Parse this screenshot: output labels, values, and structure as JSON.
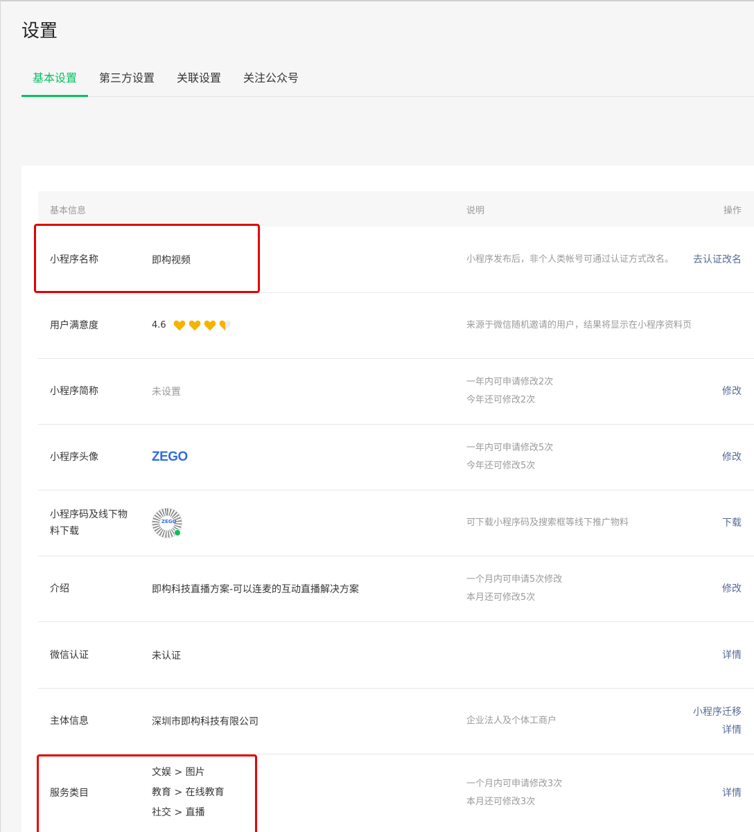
{
  "page": {
    "title": "设置"
  },
  "tabs": [
    {
      "label": "基本设置",
      "active": true
    },
    {
      "label": "第三方设置",
      "active": false
    },
    {
      "label": "关联设置",
      "active": false
    },
    {
      "label": "关注公众号",
      "active": false
    }
  ],
  "table": {
    "headers": {
      "info": "基本信息",
      "desc": "说明",
      "op": "操作"
    },
    "rows": [
      {
        "label": "小程序名称",
        "value": "即构视频",
        "desc": [
          "小程序发布后，非个人类帐号可通过认证方式改名。"
        ],
        "ops": [
          "去认证改名"
        ]
      },
      {
        "label": "用户满意度",
        "value": "4.6",
        "rating": 3.5,
        "desc": [
          "来源于微信随机邀请的用户，结果将显示在小程序资料页"
        ],
        "ops": []
      },
      {
        "label": "小程序简称",
        "value": "未设置",
        "desc": [
          "一年内可申请修改2次",
          "今年还可修改2次"
        ],
        "ops": [
          "修改"
        ]
      },
      {
        "label": "小程序头像",
        "value": "ZEGO",
        "desc": [
          "一年内可申请修改5次",
          "今年还可修改5次"
        ],
        "ops": [
          "修改"
        ]
      },
      {
        "label": "小程序码及线下物料下载",
        "value": "ZEGO",
        "desc": [
          "可下载小程序码及搜索框等线下推广物料"
        ],
        "ops": [
          "下载"
        ]
      },
      {
        "label": "介绍",
        "value": "即构科技直播方案-可以连麦的互动直播解决方案",
        "desc": [
          "一个月内可申请5次修改",
          "本月还可修改5次"
        ],
        "ops": [
          "修改"
        ]
      },
      {
        "label": "微信认证",
        "value": "未认证",
        "desc": [],
        "ops": [
          "详情"
        ]
      },
      {
        "label": "主体信息",
        "value": "深圳市即构科技有限公司",
        "desc": [
          "企业法人及个体工商户"
        ],
        "ops": [
          "小程序迁移",
          "详情"
        ]
      },
      {
        "label": "服务类目",
        "categories": [
          "文娱 > 图片",
          "教育 > 在线教育",
          "社交 > 直播"
        ],
        "desc": [
          "一个月内可申请修改3次",
          "本月还可修改3次"
        ],
        "ops": [
          "详情"
        ]
      }
    ]
  },
  "colors": {
    "accent": "#07c160",
    "link": "#576b95",
    "highlight": "#e60000",
    "heart": "#f5b400",
    "logo": "#2f6de1"
  }
}
